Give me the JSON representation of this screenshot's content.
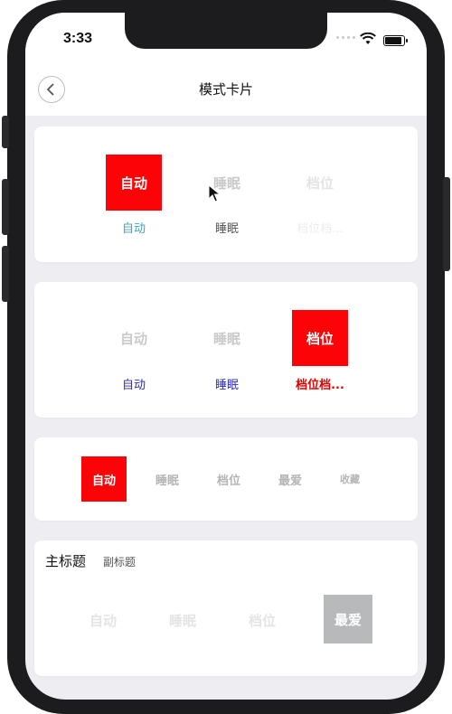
{
  "status": {
    "time": "3:33"
  },
  "nav": {
    "title": "模式卡片"
  },
  "card1": {
    "tiles": [
      "自动",
      "睡眠",
      "档位"
    ],
    "subs": [
      "自动",
      "睡眠",
      "档位档..."
    ]
  },
  "card2": {
    "tiles": [
      "自动",
      "睡眠",
      "档位"
    ],
    "subs": [
      "自动",
      "睡眠",
      "档位档..."
    ]
  },
  "card3": {
    "chips": [
      "自动",
      "睡眠",
      "档位",
      "最爱",
      "收藏"
    ]
  },
  "card4": {
    "main_title": "主标题",
    "sub_title": "副标题",
    "tiles": [
      "自动",
      "睡眠",
      "档位",
      "最爱"
    ]
  },
  "colors": {
    "accent_red": "#fb0307",
    "teal": "#3aa6b9",
    "blue": "#2b2bbf",
    "gray_tile": "#b7b9bb"
  }
}
